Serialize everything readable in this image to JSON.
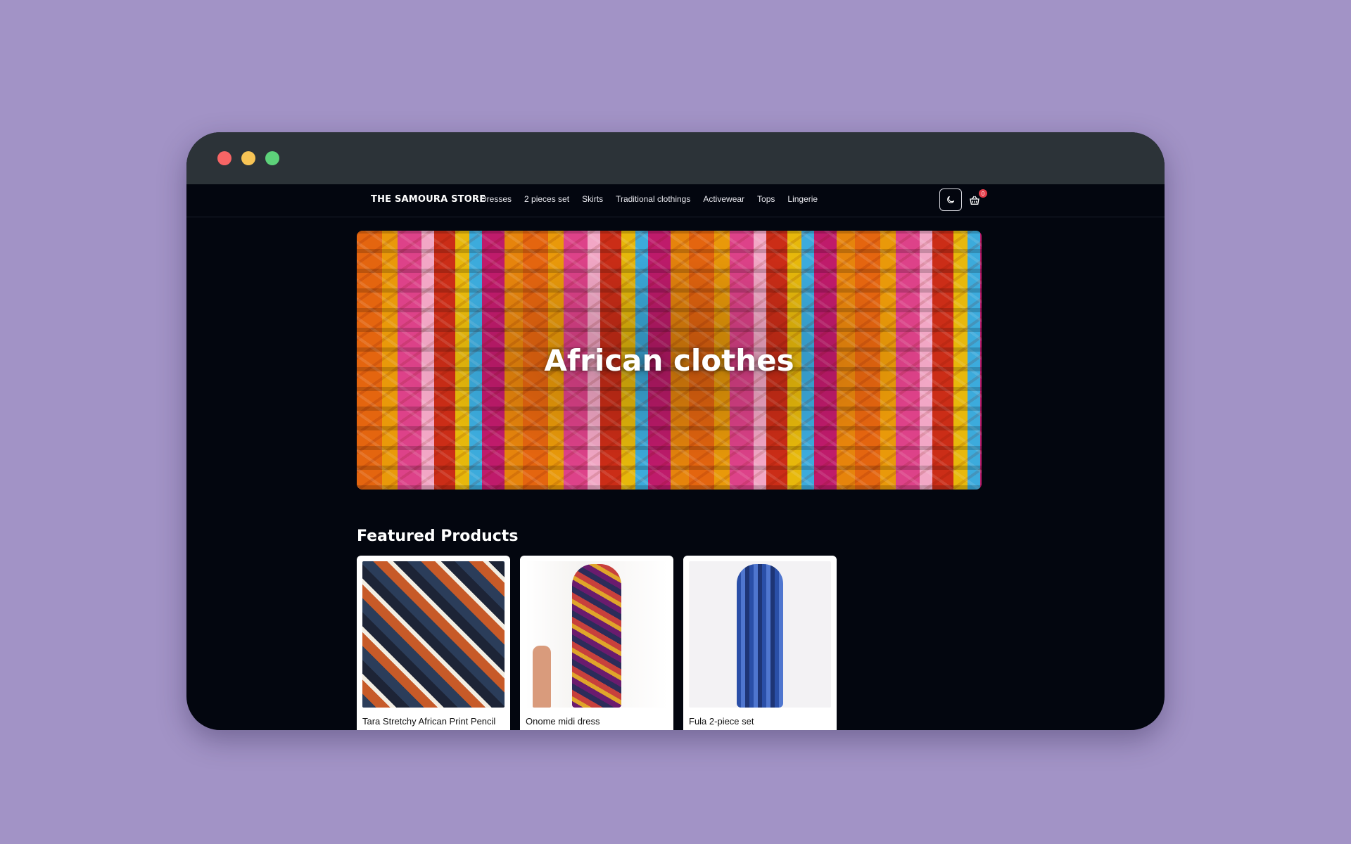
{
  "window": {
    "controls": {
      "close_color": "#f76565",
      "minimize_color": "#f7c455",
      "maximize_color": "#5dd27a"
    }
  },
  "navbar": {
    "brand": "THE SAMOURA STORE",
    "links": [
      "Dresses",
      "2 pieces set",
      "Skirts",
      "Traditional clothings",
      "Activewear",
      "Tops",
      "Lingerie"
    ],
    "theme_icon": "moon-icon",
    "cart_icon": "basket-icon",
    "cart_count": "0"
  },
  "hero": {
    "title": "African clothes"
  },
  "featured": {
    "title": "Featured Products",
    "products": [
      {
        "name": "Tara Stretchy African Print Pencil"
      },
      {
        "name": "Onome midi dress"
      },
      {
        "name": "Fula 2-piece set"
      }
    ]
  },
  "colors": {
    "background": "#a293c6",
    "page": "#03060f",
    "titlebar": "#2c3338",
    "badge": "#e53d4a"
  }
}
